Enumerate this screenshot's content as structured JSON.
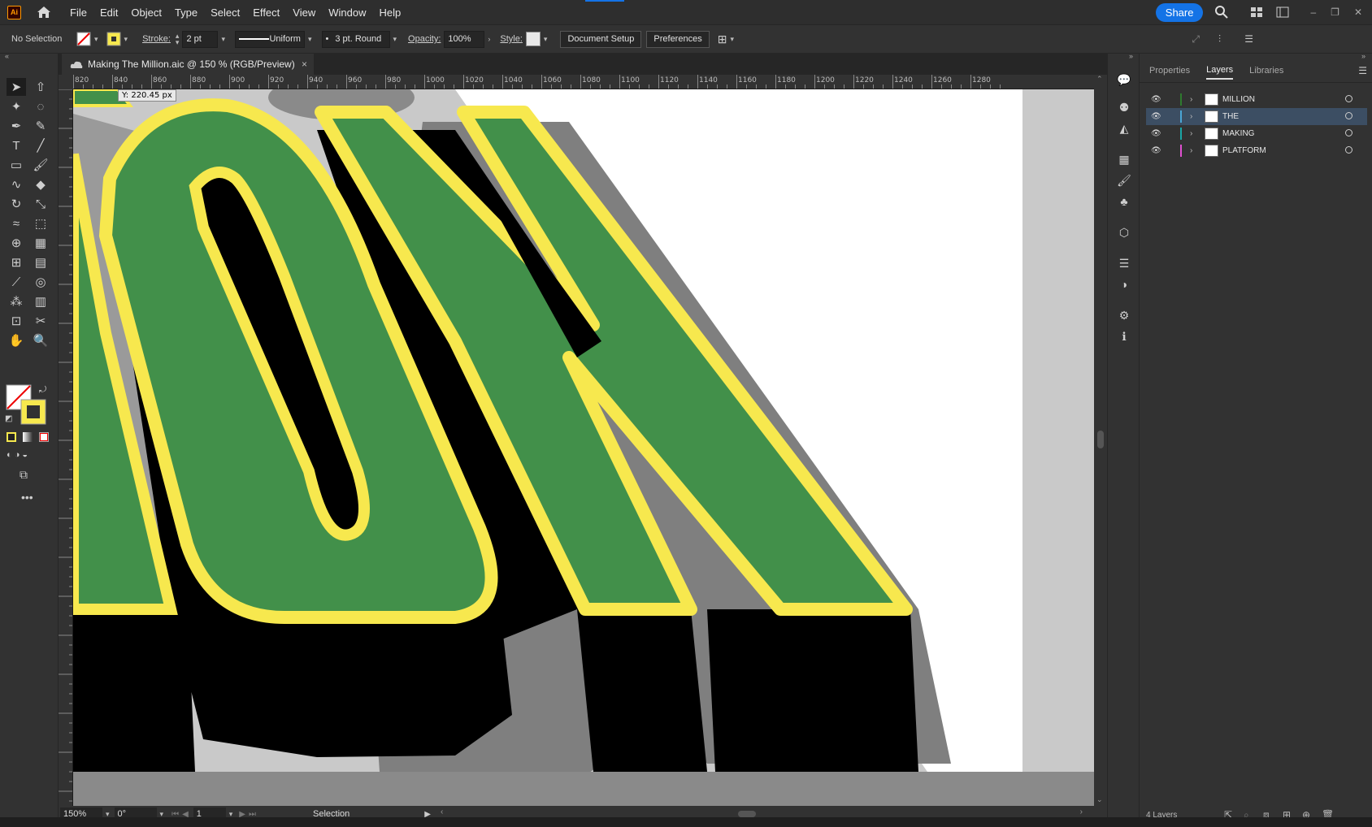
{
  "app": {
    "logo": "Ai"
  },
  "menu": [
    "File",
    "Edit",
    "Object",
    "Type",
    "Select",
    "Effect",
    "View",
    "Window",
    "Help"
  ],
  "share_label": "Share",
  "control": {
    "selection": "No Selection",
    "stroke_label": "Stroke:",
    "stroke_value": "2 pt",
    "profile": "Uniform",
    "brush": "3 pt. Round",
    "opacity_label": "Opacity:",
    "opacity_value": "100%",
    "style_label": "Style:",
    "document_setup": "Document Setup",
    "preferences": "Preferences"
  },
  "document": {
    "tab_title": "Making The Million.aic @ 150 % (RGB/Preview)",
    "close": "×"
  },
  "ruler_labels": [
    "820",
    "840",
    "860",
    "880",
    "900",
    "920",
    "940",
    "960",
    "980",
    "1000",
    "1020",
    "1040",
    "1060",
    "1080",
    "1100",
    "1120",
    "1140",
    "1160",
    "1180",
    "1200",
    "1220",
    "1240",
    "1260",
    "1280"
  ],
  "tooltip": "Y: 220.45 px",
  "status": {
    "zoom": "150%",
    "rotation": "0°",
    "artboard": "1",
    "tool": "Selection"
  },
  "panel": {
    "tabs": [
      "Properties",
      "Layers",
      "Libraries"
    ],
    "active_tab": "Layers",
    "layers": [
      {
        "name": "MILLION",
        "color": "#2f7a2f",
        "selected": false
      },
      {
        "name": "THE",
        "color": "#4aa6d6",
        "selected": true
      },
      {
        "name": "MAKING",
        "color": "#1aa6a6",
        "selected": false
      },
      {
        "name": "PLATFORM",
        "color": "#e050d0",
        "selected": false
      }
    ],
    "footer": "4 Layers"
  },
  "colors": {
    "green": "#42904a",
    "yellow": "#f7e84e",
    "shadow": "#000000",
    "gray_shadow": "#7f7f7f",
    "accent": "#1473e6"
  }
}
